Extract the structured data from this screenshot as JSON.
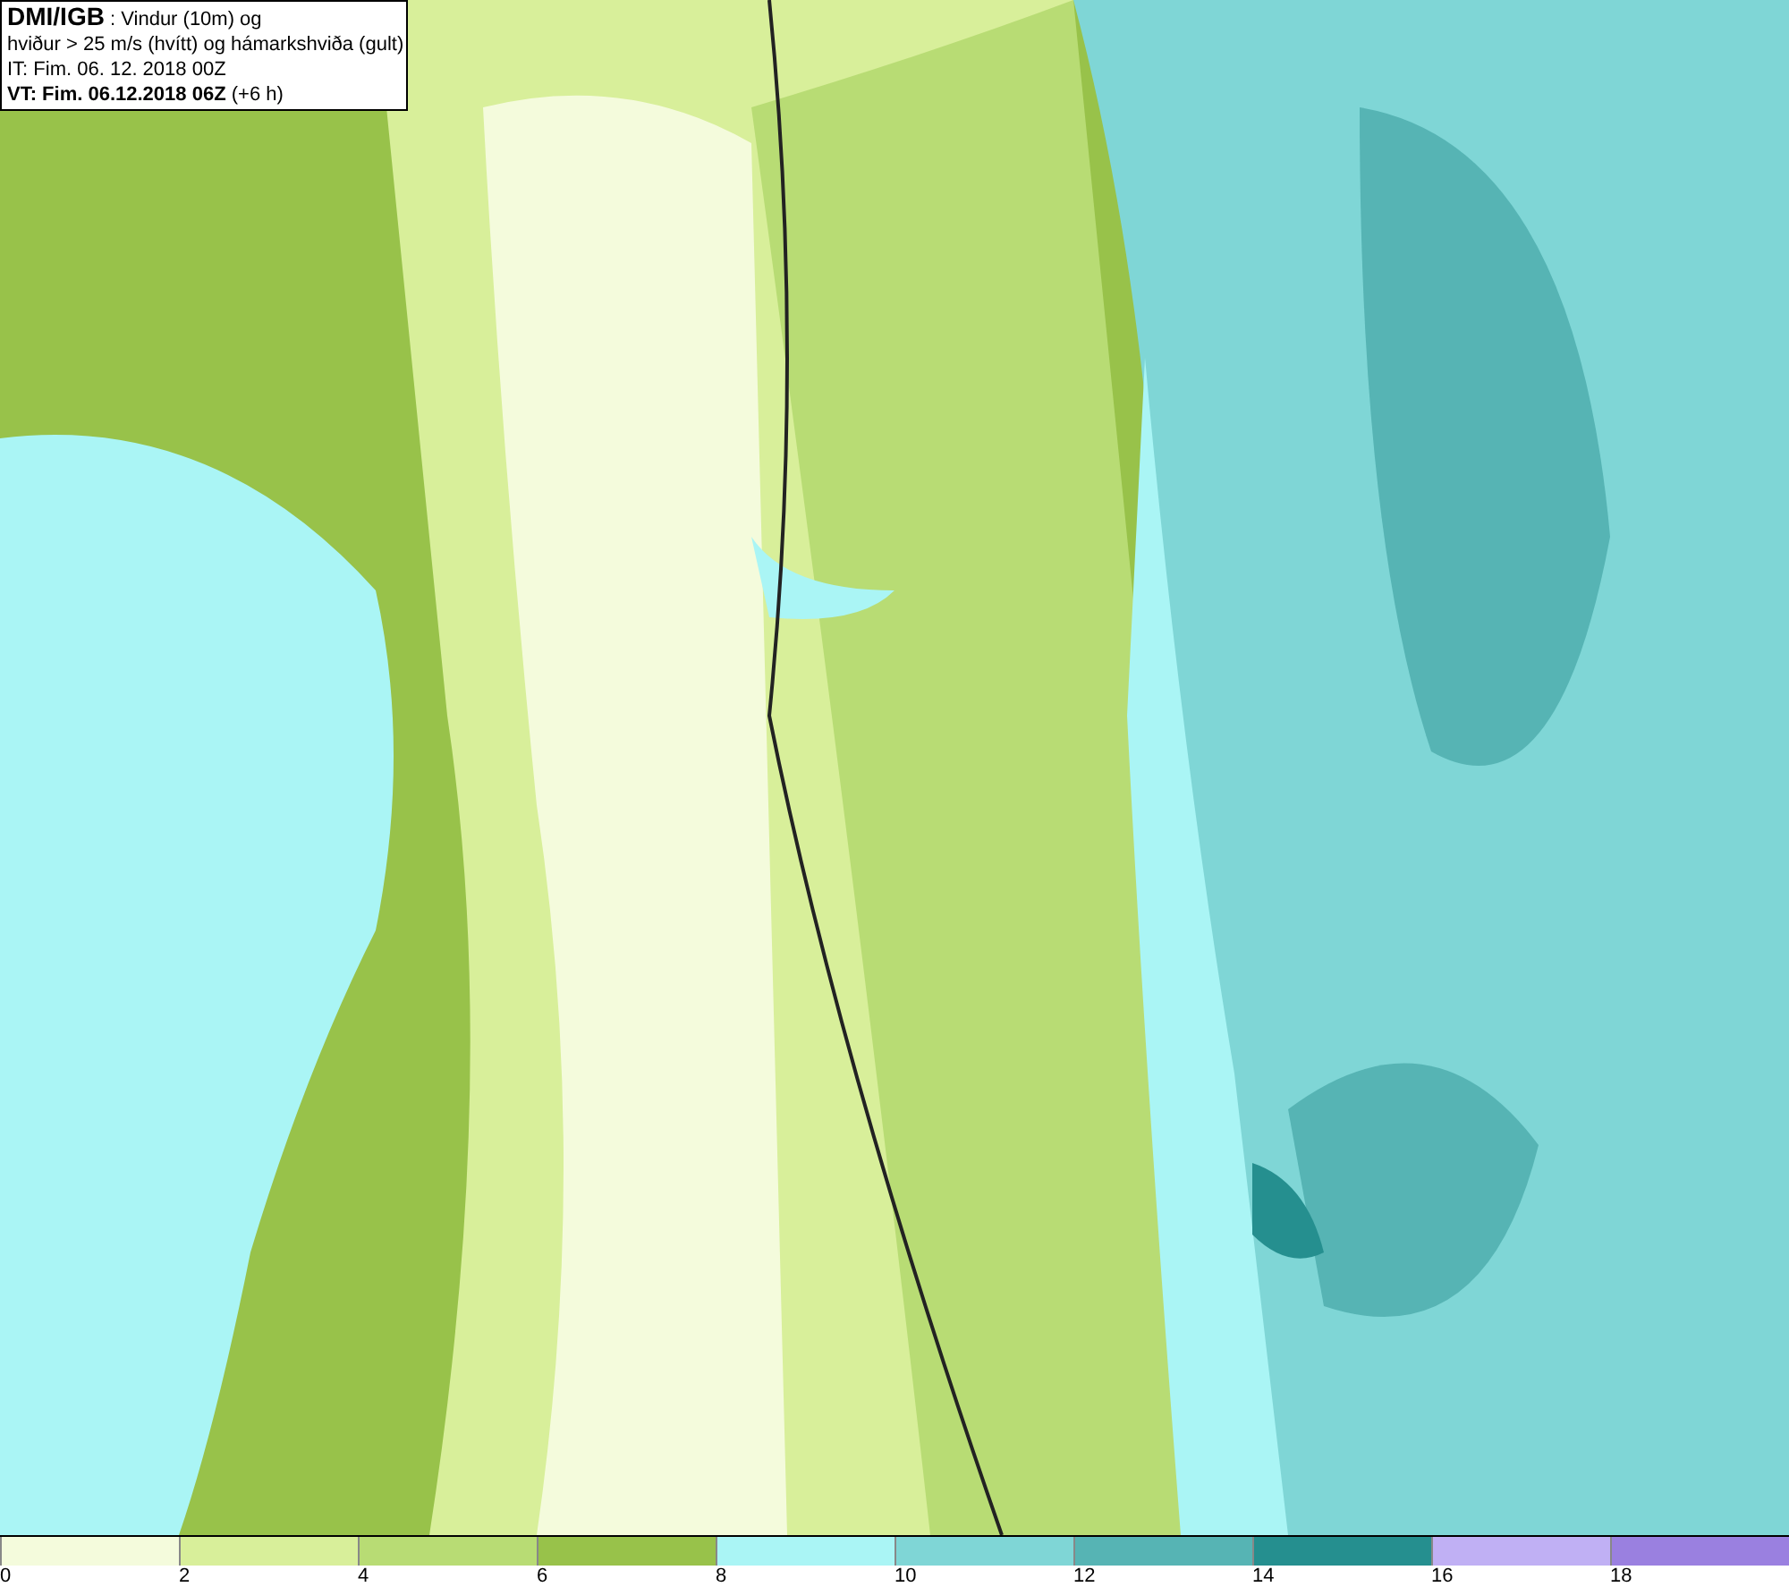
{
  "header": {
    "lines": [
      "**DMI/IGB** : Vindur (10m) og",
      "hviður > 25 m/s (hvítt) og hámarkshviða (gult)",
      "IT: Fim. 06. 12. 2018 00Z",
      "**VT: Fim. 06.12.2018 06Z** (+6 h)"
    ]
  },
  "legend": {
    "bins": [
      {
        "color": "#f4fbdc",
        "label": "0"
      },
      {
        "color": "#d8ef9a",
        "label": "2"
      },
      {
        "color": "#b8dc74",
        "label": "4"
      },
      {
        "color": "#98c24a",
        "label": "6"
      },
      {
        "color": "#aaf5f5",
        "label": "8"
      },
      {
        "color": "#7fd6d6",
        "label": "10"
      },
      {
        "color": "#56b4b4",
        "label": "12"
      },
      {
        "color": "#258f8f",
        "label": "14"
      },
      {
        "color": "#c0b0f4",
        "label": "16"
      },
      {
        "color": "#9a80e0",
        "label": "18"
      }
    ]
  }
}
